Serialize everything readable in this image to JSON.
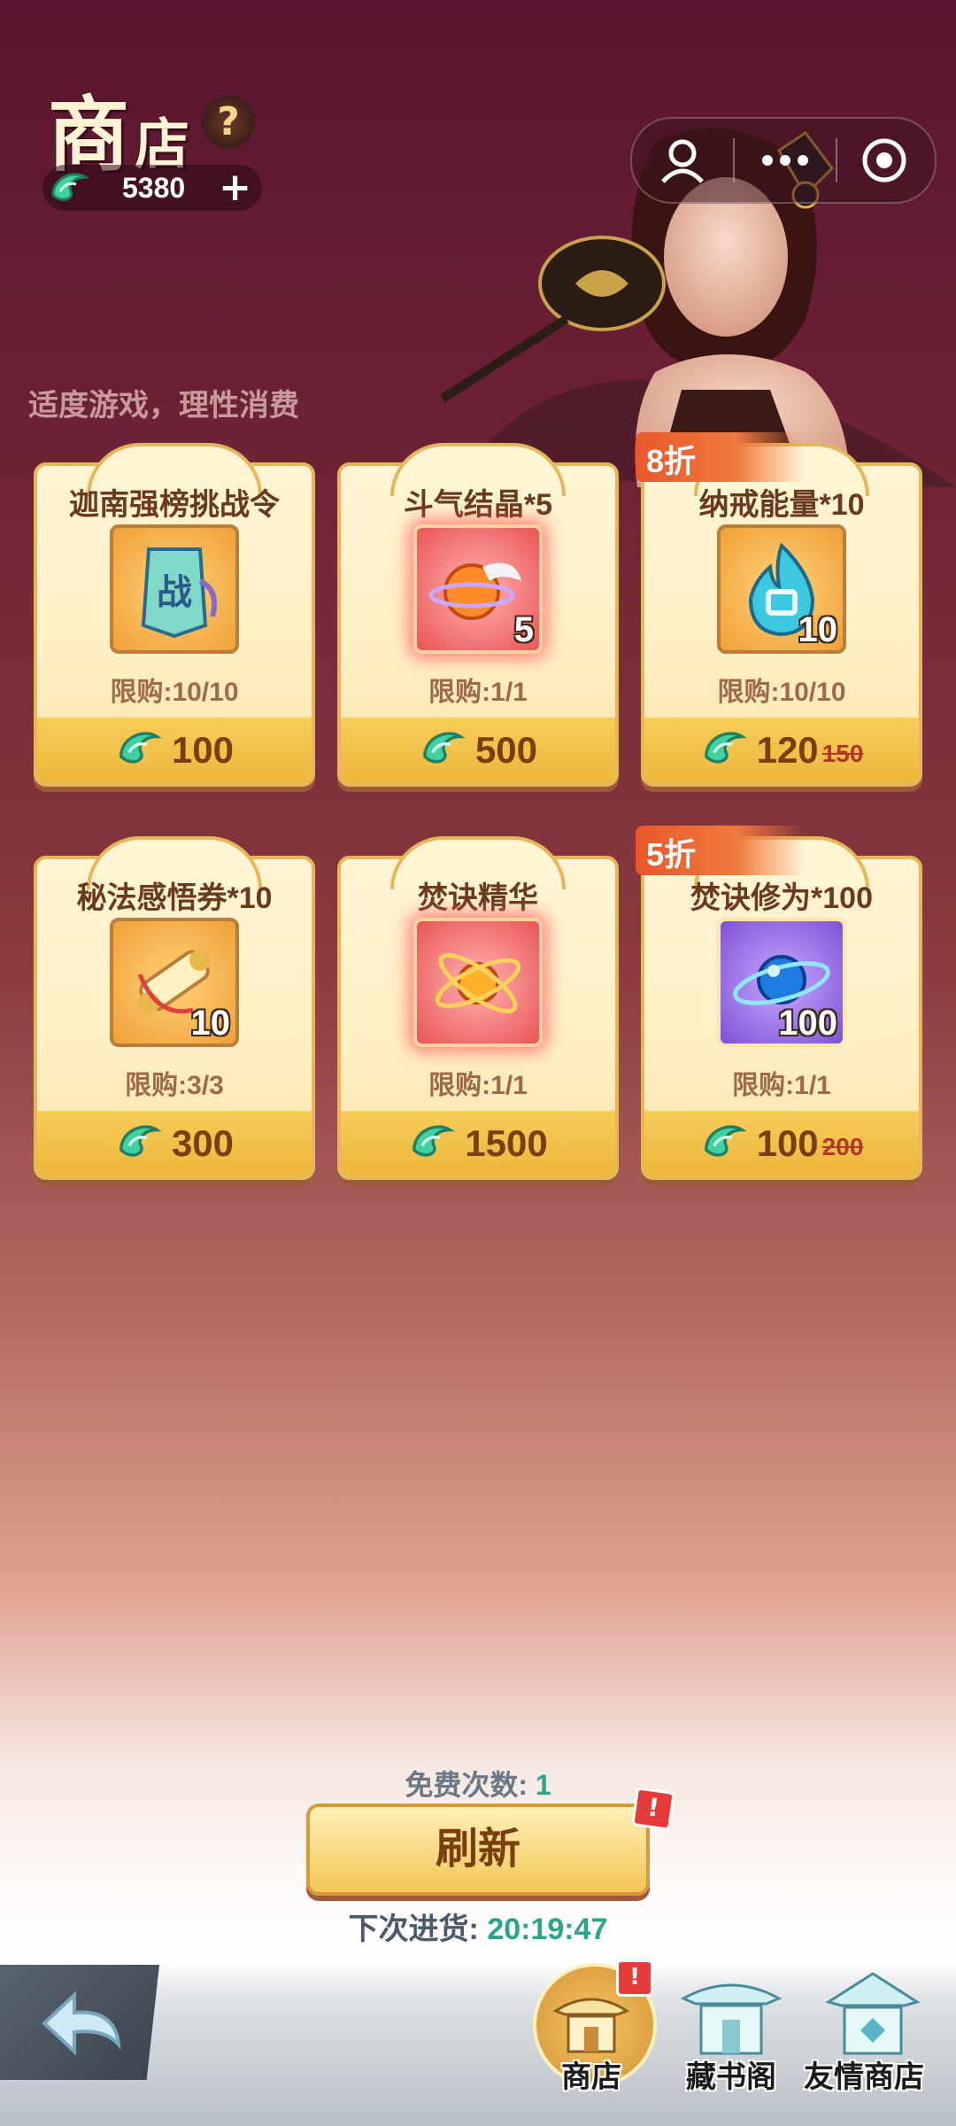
{
  "header": {
    "title_big": "商",
    "title_small": "店",
    "help_label": "?",
    "currency_amount": "5380",
    "plus_label": "+",
    "notice": "适度游戏，理性消费"
  },
  "shop_items": [
    {
      "name": "迦南强榜挑战令",
      "limit": "限购:10/10",
      "price": "100",
      "old_price": "",
      "qty": "",
      "discount": ""
    },
    {
      "name": "斗气结晶*5",
      "limit": "限购:1/1",
      "price": "500",
      "old_price": "",
      "qty": "5",
      "discount": ""
    },
    {
      "name": "纳戒能量*10",
      "limit": "限购:10/10",
      "price": "120",
      "old_price": "150",
      "qty": "10",
      "discount": "8折"
    },
    {
      "name": "秘法感悟券*10",
      "limit": "限购:3/3",
      "price": "300",
      "old_price": "",
      "qty": "10",
      "discount": ""
    },
    {
      "name": "焚诀精华",
      "limit": "限购:1/1",
      "price": "1500",
      "old_price": "",
      "qty": "",
      "discount": ""
    },
    {
      "name": "焚诀修为*100",
      "limit": "限购:1/1",
      "price": "100",
      "old_price": "200",
      "qty": "100",
      "discount": "5折"
    }
  ],
  "bottom": {
    "free_label": "免费次数:",
    "free_count": "1",
    "refresh_label": "刷新",
    "refresh_badge": "!",
    "restock_label": "下次进货:",
    "restock_time": "20:19:47"
  },
  "nav": {
    "tab_shop": "商店",
    "tab_shop_badge": "!",
    "tab_library": "藏书阁",
    "tab_friend_shop": "友情商店"
  },
  "colors": {
    "accent_green": "#2aa58a",
    "card_gold": "#f3c654",
    "discount_orange": "#e9572b"
  }
}
